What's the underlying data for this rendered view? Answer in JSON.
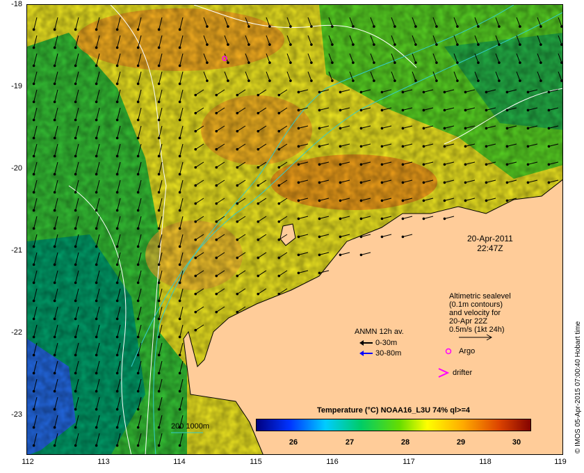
{
  "axes": {
    "x_ticks": [
      "112",
      "113",
      "114",
      "115",
      "116",
      "117",
      "118",
      "119"
    ],
    "y_ticks": [
      "-18",
      "-19",
      "-20",
      "-21",
      "-22",
      "-23"
    ]
  },
  "date": {
    "line1": "20-Apr-2011",
    "line2": "22:47Z"
  },
  "altimetry_note": [
    "Altimetric sealevel",
    "(0.1m contours)",
    "and velocity for",
    "20-Apr 22Z",
    "0.5m/s (1kt 24h)"
  ],
  "legend": {
    "anmn_title": "ANMN 12h av.",
    "anmn_shallow": "0-30m",
    "anmn_deep": "30-80m",
    "argo": "Argo",
    "drifter": "drifter",
    "isobath": "200  1000m"
  },
  "colorbar": {
    "title": "Temperature (°C) NOAA16_L3U 74% ql>=4",
    "ticks": [
      "26",
      "27",
      "28",
      "29",
      "30"
    ]
  },
  "credit": "© IMOS 05-Apr-2015 07:00:40 Hobart time",
  "colors": {
    "land": "#ffcc99",
    "arrow": "#000000",
    "argo": "#ff00ff",
    "isobath": "#33cccc",
    "contour": "#ffffff"
  }
}
